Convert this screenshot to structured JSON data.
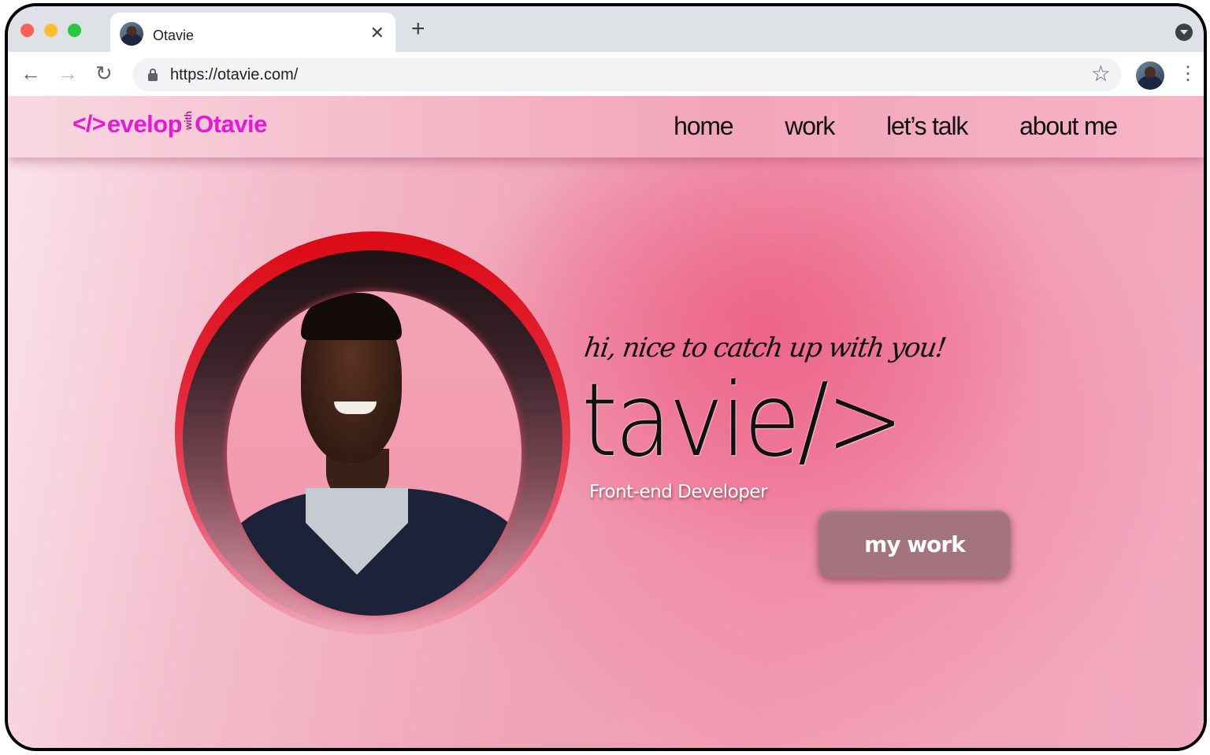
{
  "browser": {
    "tab": {
      "title": "Otavie",
      "close_label": "✕"
    },
    "new_tab_label": "+",
    "url": "https://otavie.com/",
    "icons": {
      "back": "←",
      "forward": "→",
      "reload": "↻",
      "star": "☆",
      "menu": "⋮"
    }
  },
  "site": {
    "logo": {
      "brackets": "</>",
      "word": "evelop",
      "with": "with",
      "name": "Otavie"
    },
    "nav": [
      {
        "label": "home"
      },
      {
        "label": "work"
      },
      {
        "label": "let’s talk"
      },
      {
        "label": "about me"
      }
    ],
    "hero": {
      "greeting": "hi, nice to catch up with you!",
      "name": "tavie/>",
      "role": "Front-end Developer",
      "cta_label": "my work"
    },
    "colors": {
      "logo": "#e619d4",
      "ring": "#dc0a14",
      "cta": "#a3737e",
      "background": "#f19db4"
    }
  }
}
